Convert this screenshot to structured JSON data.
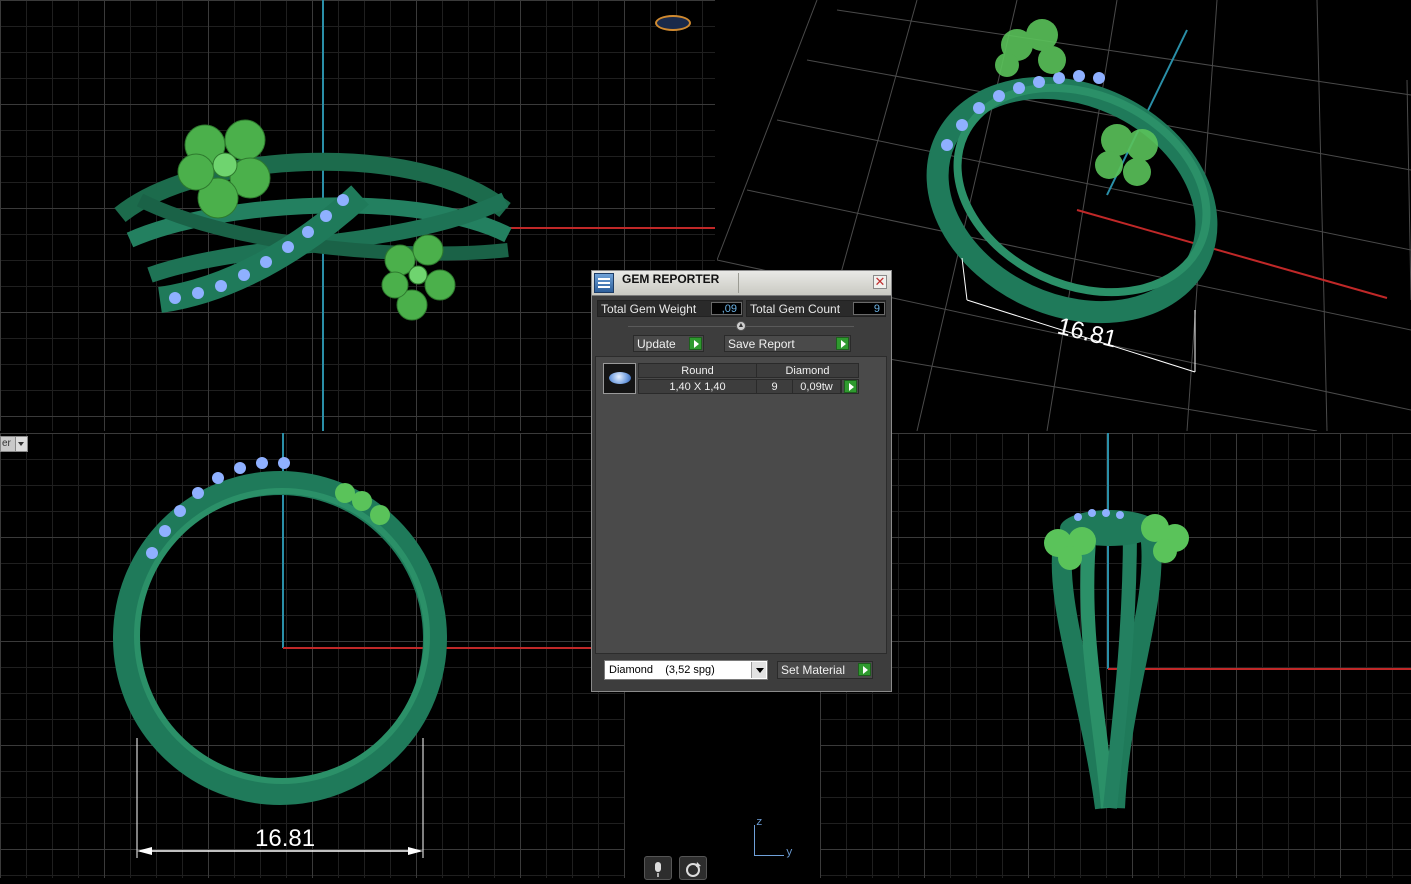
{
  "dialog": {
    "title": "GEM REPORTER",
    "total_gem_weight_label": "Total Gem Weight",
    "total_gem_weight_value": ",09",
    "total_gem_count_label": "Total Gem Count",
    "total_gem_count_value": "9",
    "update_label": "Update",
    "save_report_label": "Save Report",
    "gem_list": [
      {
        "shape": "Round",
        "size": "1,40 X 1,40",
        "material": "Diamond",
        "count": "9",
        "weight": "0,09tw"
      }
    ],
    "material_select_value": "Diamond    (3,52 spg)",
    "set_material_label": "Set Material"
  },
  "viewports": {
    "bottom_left_dimension": "16.81",
    "top_right_dimension": "16.81",
    "view_dropdown_text": "er"
  },
  "axis_indicator": {
    "z": "z",
    "y": "y"
  },
  "colors": {
    "ring_green": "#1f7a5a",
    "flower_green": "#5ac35a",
    "gem_blue": "#8fb0ff",
    "x_axis_red": "#c02828",
    "y_axis_blue": "#2a8fa8"
  }
}
